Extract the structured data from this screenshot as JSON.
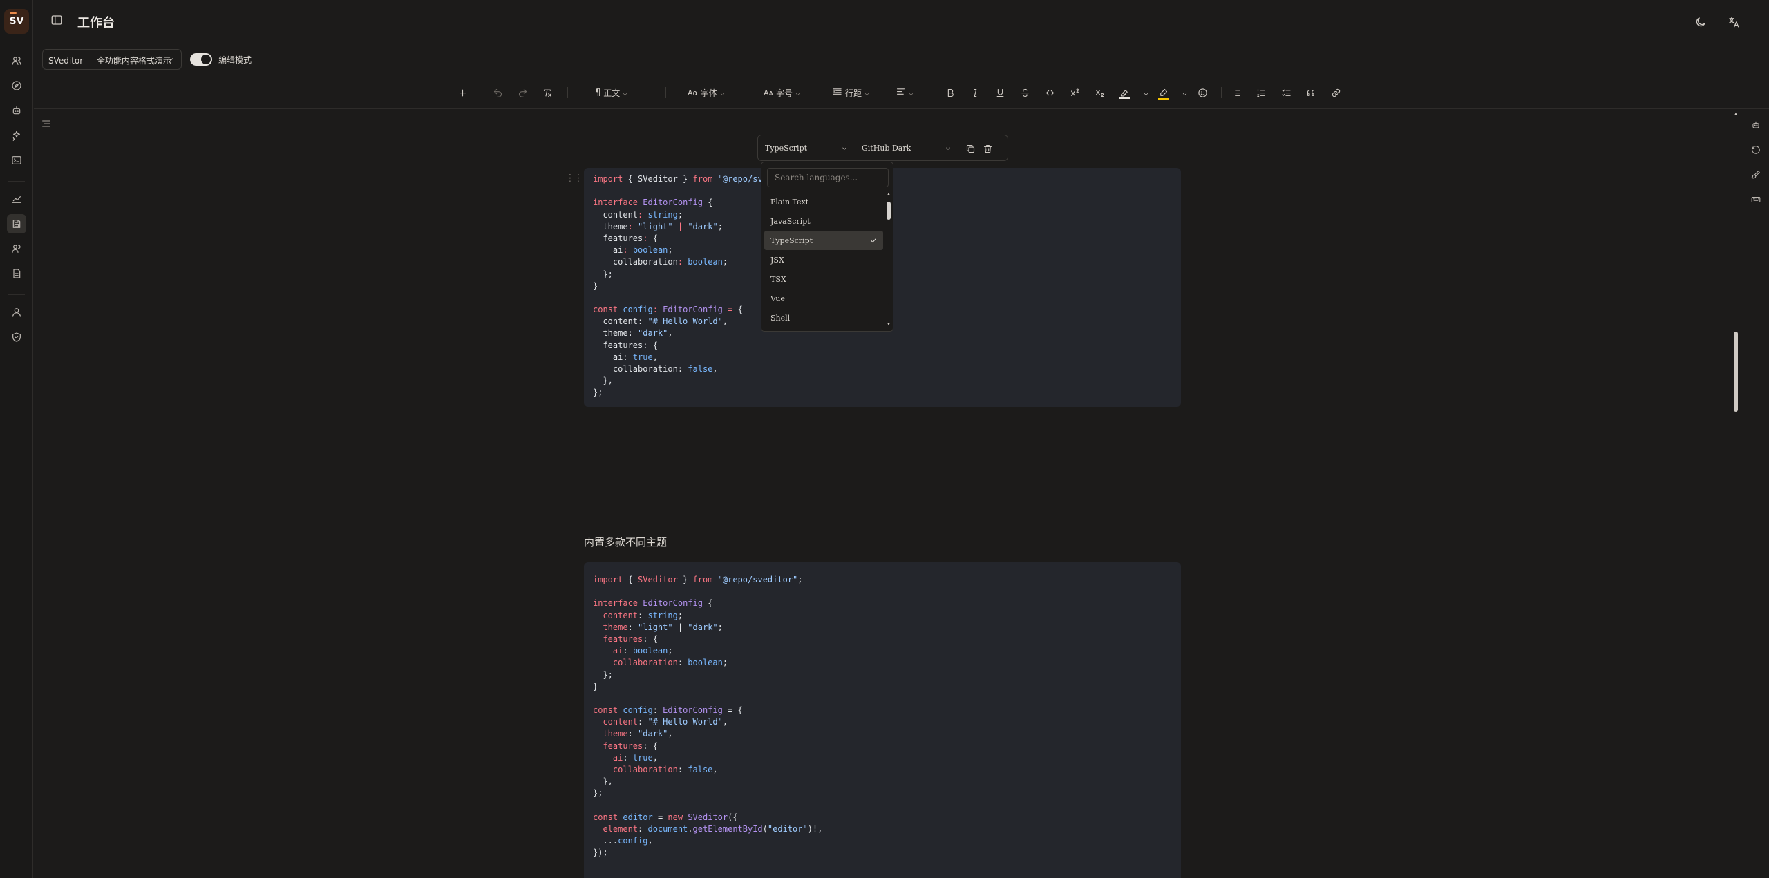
{
  "app": {
    "logo_text": "SV",
    "page_title": "工作台"
  },
  "rail": {
    "icons": [
      "users-icon",
      "compass-icon",
      "bot-icon",
      "sparkles-icon",
      "terminal-icon",
      "chart-icon",
      "save-icon",
      "team-icon",
      "file-icon",
      "user-icon",
      "shield-icon"
    ],
    "active": "save-icon"
  },
  "header": {
    "icons": [
      "moon-icon",
      "translate-icon"
    ]
  },
  "docbar": {
    "document_select": "SVeditor — 全功能内容格式演示",
    "mode_toggle_label": "编辑模式",
    "mode_toggle_on": true
  },
  "toolbar": {
    "paragraph_label": "正文",
    "font_family_label": "字体",
    "font_size_label": "字号",
    "line_height_label": "行距",
    "highlight_color": "#e6e3de",
    "text_color": "#f5c400"
  },
  "code_toolbar": {
    "language": "TypeScript",
    "theme": "GitHub Dark"
  },
  "language_dropdown": {
    "search_placeholder": "Search languages...",
    "items": [
      "Plain Text",
      "JavaScript",
      "TypeScript",
      "JSX",
      "TSX",
      "Vue",
      "Shell"
    ],
    "selected": "TypeScript"
  },
  "editor": {
    "paragraph": "内置多款不同主题",
    "code_block_1": {
      "visible_first_line": "import { SVeditor } from \"@repo/sv"
    },
    "code_block_2": {
      "first_line": "import { SVeditor } from \"@repo/sveditor\";"
    }
  }
}
